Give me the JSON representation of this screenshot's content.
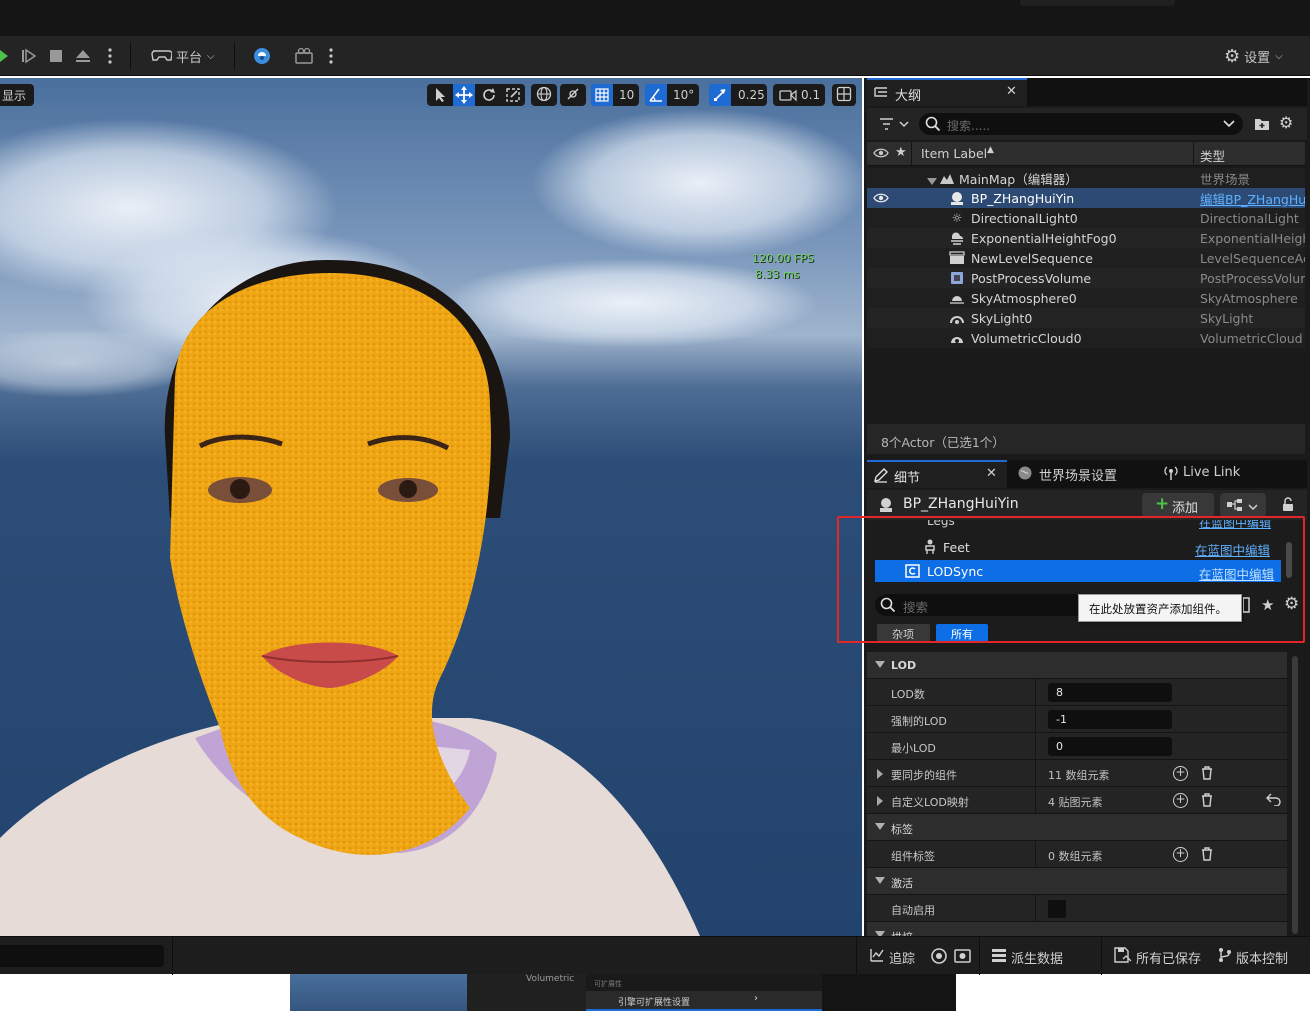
{
  "toolbar": {
    "platform_label": "平台",
    "settings_label": "设置"
  },
  "viewport": {
    "show_label": "显示",
    "grid_snap": "10",
    "rot_snap": "10°",
    "scale_snap": "0.25",
    "camera_speed": "0.1",
    "fps_line1": "120.00 FPS",
    "fps_line2": "8.33 ms"
  },
  "outliner": {
    "tab_title": "大纲",
    "search_placeholder": "搜索.....",
    "col_label": "Item Label",
    "col_type": "类型",
    "rows": [
      {
        "label": "MainMap（编辑器）",
        "type": "世界场景"
      },
      {
        "label": "BP_ZHangHuiYin",
        "type": "编辑BP_ZHangHui"
      },
      {
        "label": "DirectionalLight0",
        "type": "DirectionalLight"
      },
      {
        "label": "ExponentialHeightFog0",
        "type": "ExponentialHeight"
      },
      {
        "label": "NewLevelSequence",
        "type": "LevelSequenceAc"
      },
      {
        "label": "PostProcessVolume",
        "type": "PostProcessVolur"
      },
      {
        "label": "SkyAtmosphere0",
        "type": "SkyAtmosphere"
      },
      {
        "label": "SkyLight0",
        "type": "SkyLight"
      },
      {
        "label": "VolumetricCloud0",
        "type": "VolumetricCloud"
      }
    ],
    "status": "8个Actor（已选1个）"
  },
  "details": {
    "tab_details": "细节",
    "tab_world": "世界场景设置",
    "tab_livelink": "Live Link",
    "actor_name": "BP_ZHangHuiYin",
    "add_label": "添加",
    "components": [
      {
        "name": "Legs",
        "action": "在蓝图中编辑"
      },
      {
        "name": "Feet",
        "action": "在蓝图中编辑"
      },
      {
        "name": "LODSync",
        "action": "在蓝图中编辑"
      }
    ],
    "search_placeholder": "搜索",
    "tooltip": "在此处放置资产添加组件。",
    "filter_misc": "杂项",
    "filter_all": "所有",
    "cat_lod": "LOD",
    "lod_count_label": "LOD数",
    "lod_count_value": "8",
    "forced_lod_label": "强制的LOD",
    "forced_lod_value": "-1",
    "min_lod_label": "最小LOD",
    "min_lod_value": "0",
    "sync_components_label": "要同步的组件",
    "sync_components_value": "11 数组元素",
    "custom_lod_label": "自定义LOD映射",
    "custom_lod_value": "4 贴图元素",
    "cat_tags": "标签",
    "component_tags_label": "组件标签",
    "component_tags_value": "0 数组元素",
    "cat_activation": "激活",
    "auto_activate_label": "自动启用",
    "cat_cut": "烘焙"
  },
  "statusbar": {
    "trace": "追踪",
    "derived_data": "派生数据",
    "all_saved": "所有已保存",
    "version_control": "版本控制"
  },
  "bottom_strip": {
    "item": "Volumetric",
    "section_hint": "可扩展性",
    "engine_scalability": "引擎可扩展性设置"
  },
  "colors": {
    "accent_blue": "#1f6bd4",
    "selection_blue": "#0e6ee6",
    "highlight_red": "#e3262a",
    "overlay_orange": "#f3a912"
  }
}
